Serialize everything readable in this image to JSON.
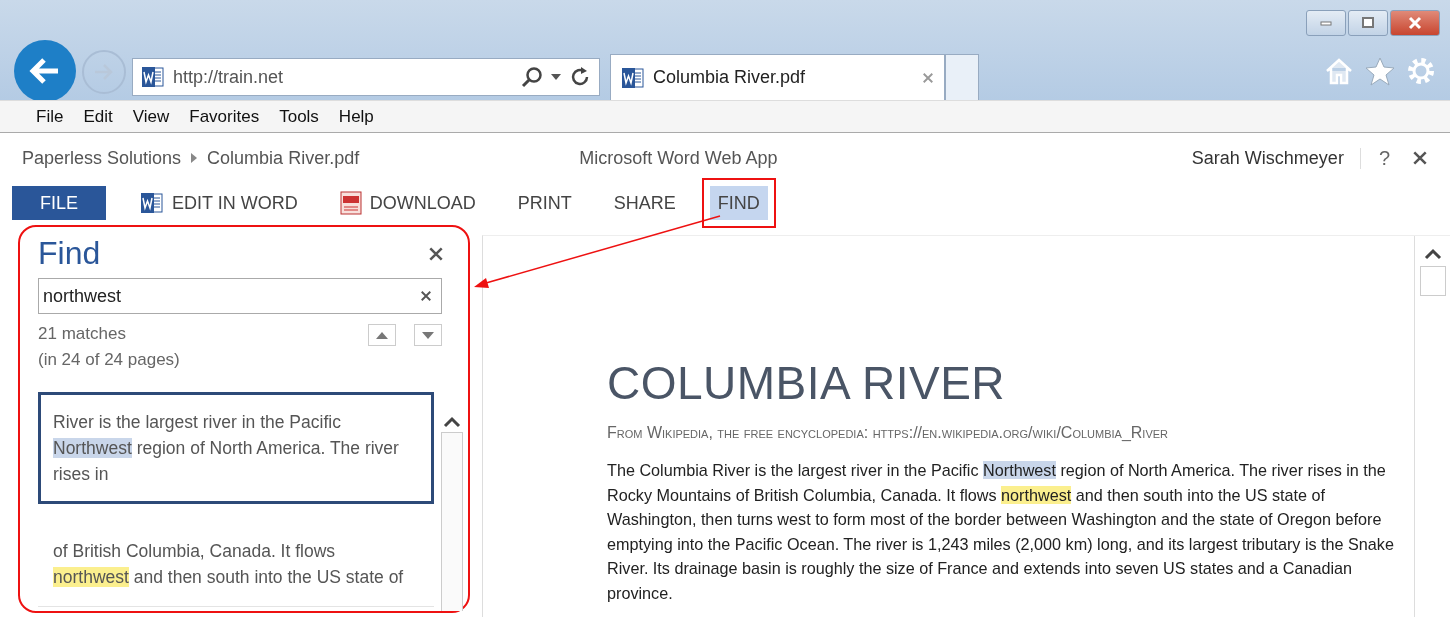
{
  "window": {
    "controls": [
      {
        "kind": "minimize"
      },
      {
        "kind": "maximize"
      },
      {
        "kind": "close"
      }
    ]
  },
  "address_bar": {
    "url": "http://train.net"
  },
  "tabs": [
    {
      "title": "Columbia River.pdf",
      "selected": true
    }
  ],
  "menu": [
    "File",
    "Edit",
    "View",
    "Favorites",
    "Tools",
    "Help"
  ],
  "app_header": {
    "breadcrumb": [
      "Paperless Solutions",
      "Columbia River.pdf"
    ],
    "app_name": "Microsoft Word Web App",
    "user": "Sarah Wischmeyer",
    "help": "?"
  },
  "ribbon": [
    {
      "label": "FILE",
      "kind": "file",
      "selected": false
    },
    {
      "label": "EDIT IN WORD",
      "kind": "word",
      "selected": false
    },
    {
      "label": "DOWNLOAD",
      "kind": "pdf",
      "selected": false
    },
    {
      "label": "PRINT",
      "kind": "plain",
      "selected": false
    },
    {
      "label": "SHARE",
      "kind": "plain",
      "selected": false
    },
    {
      "label": "FIND",
      "kind": "plain",
      "selected": true
    }
  ],
  "find_panel": {
    "title": "Find",
    "query": "northwest",
    "matches": "21 matches",
    "pages": "(in 24 of 24 pages)",
    "results": [
      {
        "selected": true,
        "segments": [
          {
            "text": "River is the largest river in the Pacific ",
            "kind": "plain"
          },
          {
            "text": "Northwest",
            "kind": "current"
          },
          {
            "text": " region of North America. The river rises in",
            "kind": "plain"
          }
        ]
      },
      {
        "selected": false,
        "segments": [
          {
            "text": "of British Columbia, Canada. It flows ",
            "kind": "plain"
          },
          {
            "text": "northwest",
            "kind": "match"
          },
          {
            "text": " and then south into the US state of",
            "kind": "plain"
          }
        ]
      }
    ]
  },
  "document": {
    "title": "COLUMBIA RIVER",
    "subtitle": "From Wikipedia, the free encyclopedia: https://en.wikipedia.org/wiki/Columbia_River",
    "paragraph": [
      {
        "text": "The Columbia River is the largest river in the Pacific ",
        "kind": "plain"
      },
      {
        "text": "Northwest",
        "kind": "current"
      },
      {
        "text": " region of North America. The river rises in the Rocky Mountains of British Columbia, Canada. It flows ",
        "kind": "plain"
      },
      {
        "text": "northwest",
        "kind": "match"
      },
      {
        "text": " and then south into the US state of Washington, then turns west to form most of the border between Washington and the state of Oregon before emptying into the Pacific Ocean. The river is 1,243 miles (2,000 km) long, and its largest tributary is the Snake River. Its drainage basin is roughly the size of France and extends into seven US states and a Canadian province.",
        "kind": "plain"
      }
    ]
  }
}
